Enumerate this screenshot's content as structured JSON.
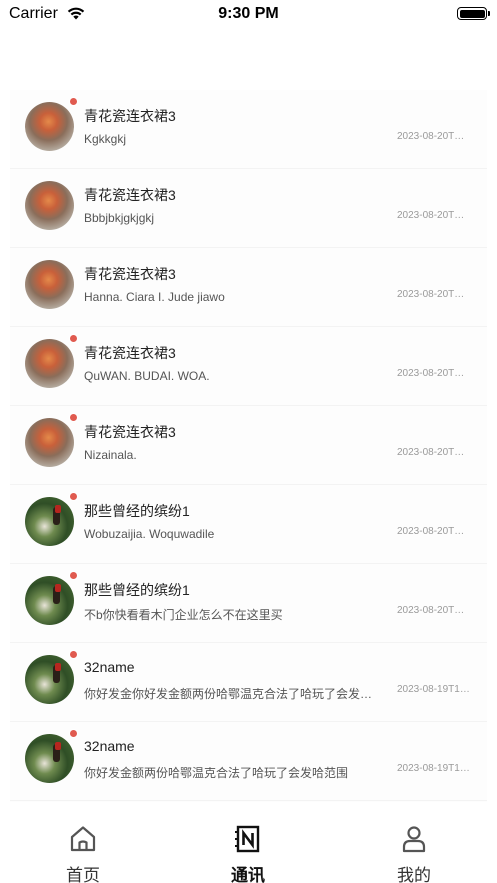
{
  "status_bar": {
    "carrier": "Carrier",
    "time": "9:30 PM",
    "battery_level": 1.0
  },
  "conversations": [
    {
      "name": "青花瓷连衣裙3",
      "message": "Kgkkgkj",
      "time": "2023-08-20T…",
      "unread": true,
      "avatar": "avatar-sunset"
    },
    {
      "name": "青花瓷连衣裙3",
      "message": "Bbbjbkjgkjgkj",
      "time": "2023-08-20T…",
      "unread": false,
      "avatar": "avatar-sunset"
    },
    {
      "name": "青花瓷连衣裙3",
      "message": "Hanna. Ciara I. Jude jiawo",
      "time": "2023-08-20T…",
      "unread": false,
      "avatar": "avatar-sunset"
    },
    {
      "name": "青花瓷连衣裙3",
      "message": "QuWAN. BUDAI. WOA.",
      "time": "2023-08-20T…",
      "unread": true,
      "avatar": "avatar-sunset"
    },
    {
      "name": "青花瓷连衣裙3",
      "message": "Nizainala.",
      "time": "2023-08-20T…",
      "unread": true,
      "avatar": "avatar-sunset"
    },
    {
      "name": "那些曾经的缤纷1",
      "message": "Wobuzaijia. Woquwadile",
      "time": "2023-08-20T…",
      "unread": true,
      "avatar": "avatar-garden"
    },
    {
      "name": "那些曾经的缤纷1",
      "message": "不b你快看看木门企业怎么不在这里买",
      "time": "2023-08-20T…",
      "unread": true,
      "avatar": "avatar-garden"
    },
    {
      "name": "32name",
      "message": "你好发金你好发金额两份哈鄂温克合法了哈玩了会发…",
      "time": "2023-08-19T1…",
      "unread": true,
      "avatar": "avatar-garden"
    },
    {
      "name": "32name",
      "message": "你好发金额两份哈鄂温克合法了哈玩了会发哈范围",
      "time": "2023-08-19T1…",
      "unread": true,
      "avatar": "avatar-garden"
    }
  ],
  "tabbar": {
    "home": {
      "label": "首页",
      "icon": "home-icon"
    },
    "contacts": {
      "label": "通讯",
      "icon": "contacts-book-icon",
      "active": true
    },
    "mine": {
      "label": "我的",
      "icon": "person-icon"
    }
  },
  "colors": {
    "unread_dot": "#e05a4f",
    "time_text": "#9a9a9a",
    "list_bg": "#fdfdfd"
  }
}
